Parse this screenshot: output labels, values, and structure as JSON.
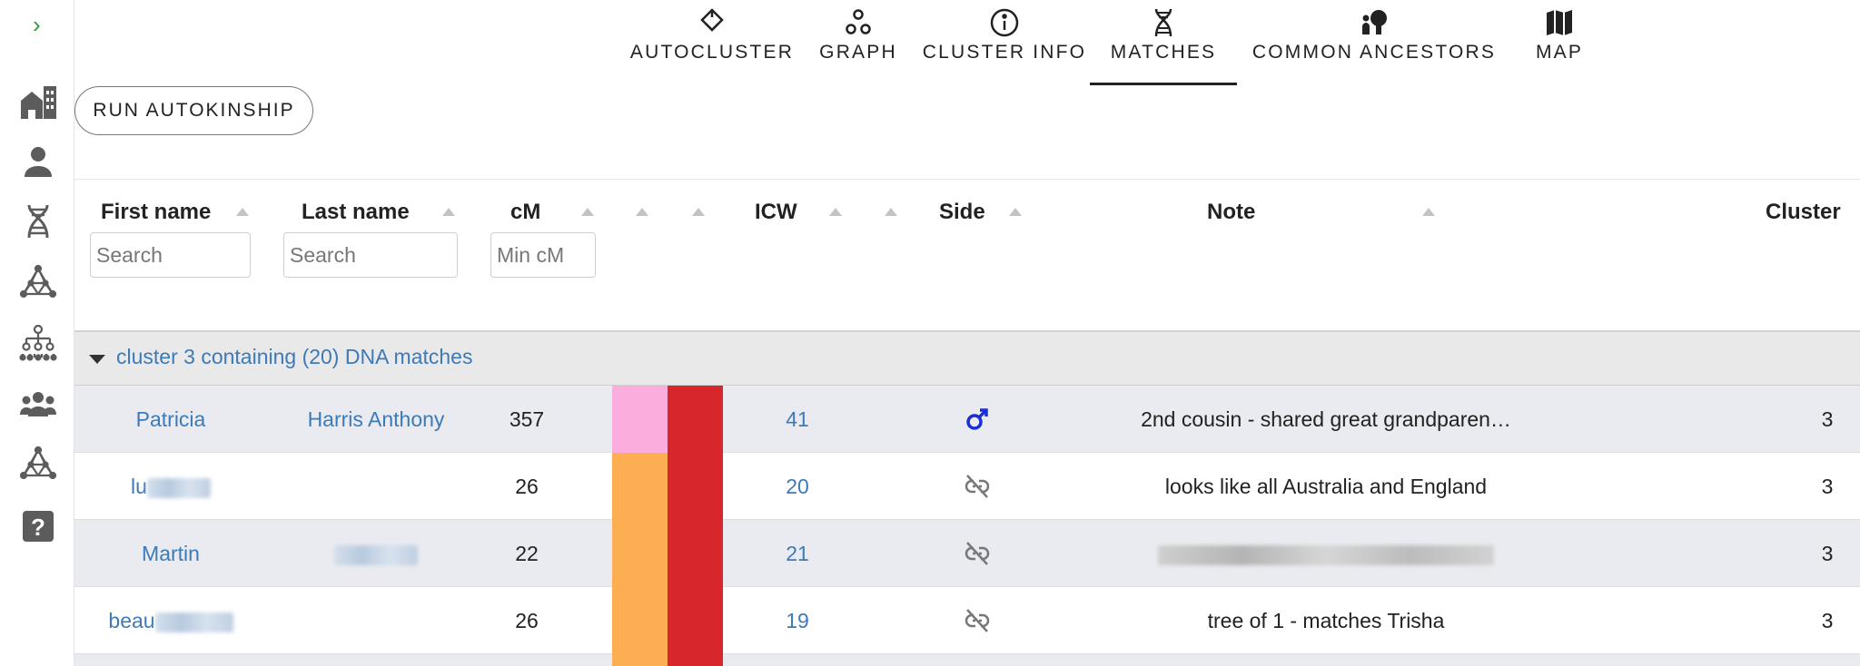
{
  "nav": {
    "tabs": [
      {
        "label": "AUTOCLUSTER",
        "icon": "autocluster-icon"
      },
      {
        "label": "GRAPH",
        "icon": "graph-icon"
      },
      {
        "label": "CLUSTER INFO",
        "icon": "info-icon"
      },
      {
        "label": "MATCHES",
        "icon": "dna-icon",
        "active": true
      },
      {
        "label": "COMMON ANCESTORS",
        "icon": "ancestor-icon"
      },
      {
        "label": "MAP",
        "icon": "map-icon"
      }
    ]
  },
  "sidebar": {
    "items": [
      "expand-icon",
      "buildings-icon",
      "person-icon",
      "dna-icon",
      "network-icon",
      "tree-icon",
      "group-icon",
      "network-icon",
      "help-icon"
    ]
  },
  "toolbar": {
    "run_label": "RUN AUTOKINSHIP"
  },
  "columns": {
    "first_name": "First name",
    "last_name": "Last name",
    "cm": "cM",
    "icw": "ICW",
    "side": "Side",
    "note": "Note",
    "cluster": "Cluster"
  },
  "filters": {
    "first_placeholder": "Search",
    "last_placeholder": "Search",
    "cm_placeholder": "Min cM"
  },
  "group": {
    "title": "cluster 3 containing (20) DNA matches"
  },
  "rows": [
    {
      "first": "Patricia",
      "last": "Harris Anthony",
      "cm": "357",
      "color1": "#fbaedd",
      "color2": "#d7272d",
      "icw": "41",
      "side": "male",
      "note": "2nd cousin - shared great grandparen…",
      "cluster": "3"
    },
    {
      "first": "lu",
      "last": "",
      "cm": "26",
      "color1": "#fdae53",
      "color2": "#d7272d",
      "icw": "20",
      "side": "unlinked",
      "note": "looks like all Australia and England",
      "cluster": "3"
    },
    {
      "first": "Martin",
      "last": "",
      "cm": "22",
      "color1": "#fdae53",
      "color2": "#d7272d",
      "icw": "21",
      "side": "unlinked",
      "note": "",
      "cluster": "3"
    },
    {
      "first": "beau",
      "last": "",
      "cm": "26",
      "color1": "#fdae53",
      "color2": "#d7272d",
      "icw": "19",
      "side": "unlinked",
      "note": "tree of 1 - matches Trisha",
      "cluster": "3"
    }
  ],
  "colors": {
    "link": "#3d7ab8",
    "accent_green": "#2e9a40",
    "male": "#1a2fd6"
  }
}
